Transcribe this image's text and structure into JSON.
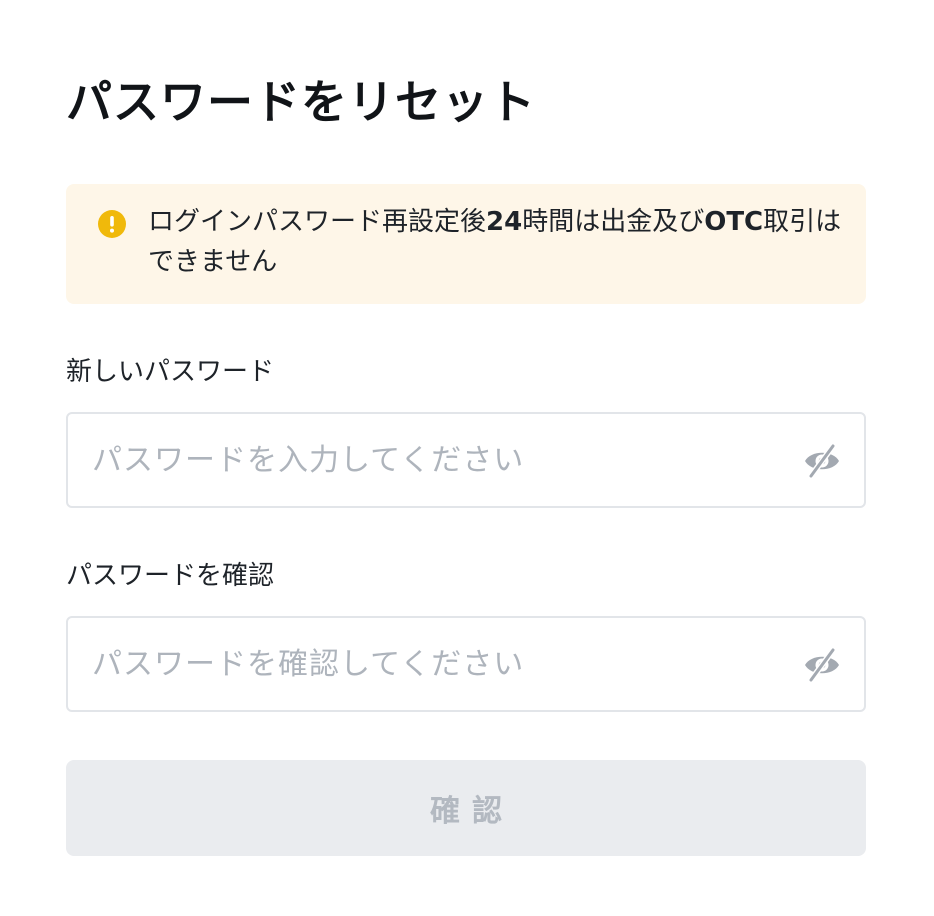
{
  "page": {
    "title": "パスワードをリセット"
  },
  "notice": {
    "icon": "warning-exclamation-icon",
    "parts": [
      {
        "text": "ログインパスワード再設定後",
        "bold": false
      },
      {
        "text": "24",
        "bold": true
      },
      {
        "text": "時間は出金及び",
        "bold": false
      },
      {
        "text": "OTC",
        "bold": true
      },
      {
        "text": "取引はできません",
        "bold": false
      }
    ],
    "color": "#f0b90b",
    "background": "#fef6e8"
  },
  "form": {
    "new_password": {
      "label": "新しいパスワード",
      "placeholder": "パスワードを入力してください",
      "value": "",
      "toggle_icon": "eye-slash-icon"
    },
    "confirm_password": {
      "label": "パスワードを確認",
      "placeholder": "パスワードを確認してください",
      "value": "",
      "toggle_icon": "eye-slash-icon"
    },
    "submit": {
      "label": "確認",
      "state": "disabled"
    }
  },
  "colors": {
    "text": "#1e2329",
    "placeholder": "#aeb4bc",
    "border": "#e2e5e9",
    "button_disabled_bg": "#eaecef",
    "button_disabled_text": "#b3b9c1",
    "icon_gray": "#a3a9b1"
  }
}
